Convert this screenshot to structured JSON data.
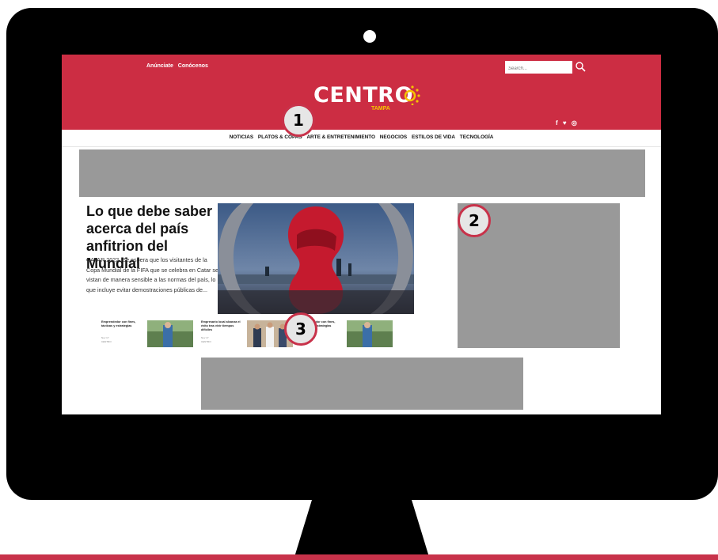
{
  "header": {
    "top_link_1": "Anúnciate",
    "top_link_2": "Conócenos",
    "search_placeholder": "Search...",
    "logo_text": "CENTRO",
    "logo_sub": "TAMPA",
    "social": [
      "f",
      "♥",
      "◎"
    ]
  },
  "nav": {
    "items": [
      "NOTICIAS",
      "PLATOS & COPAS",
      "ARTE & ENTRETENIMIENTO",
      "NEGOCIOS",
      "ESTILOS DE VIDA",
      "TECNOLOGÍA"
    ]
  },
  "article": {
    "headline": "Lo que debe saber acerca del país anfitrion del Mundial",
    "excerpt": "CATAR 2022. Se espera que los visitantes de la Copa Mundial de la FIFA que se celebra en Catar se vistan de manera sensible a las normas del país, lo que incluye evitar demostraciones públicas de..."
  },
  "thumbs": [
    {
      "title": "Emprendedor con fines, tácticas y estrategias",
      "meta_1": "Nov 17",
      "meta_2": "CENTRO"
    },
    {
      "title": "Empresario local alcanza el éxito tras vivir tiempos difíciles",
      "meta_1": "Nov 17",
      "meta_2": "CENTRO"
    },
    {
      "title": "Emprendedor con fines, tácticas y estrategias",
      "meta_1": "Nov 17",
      "meta_2": "CENTRO"
    }
  ],
  "badges": {
    "one": "1",
    "two": "2",
    "three": "3"
  },
  "colors": {
    "brand_red": "#cc2d43",
    "badge_border": "#c8324a",
    "ad_gray": "#999999",
    "monitor": "#000000"
  }
}
